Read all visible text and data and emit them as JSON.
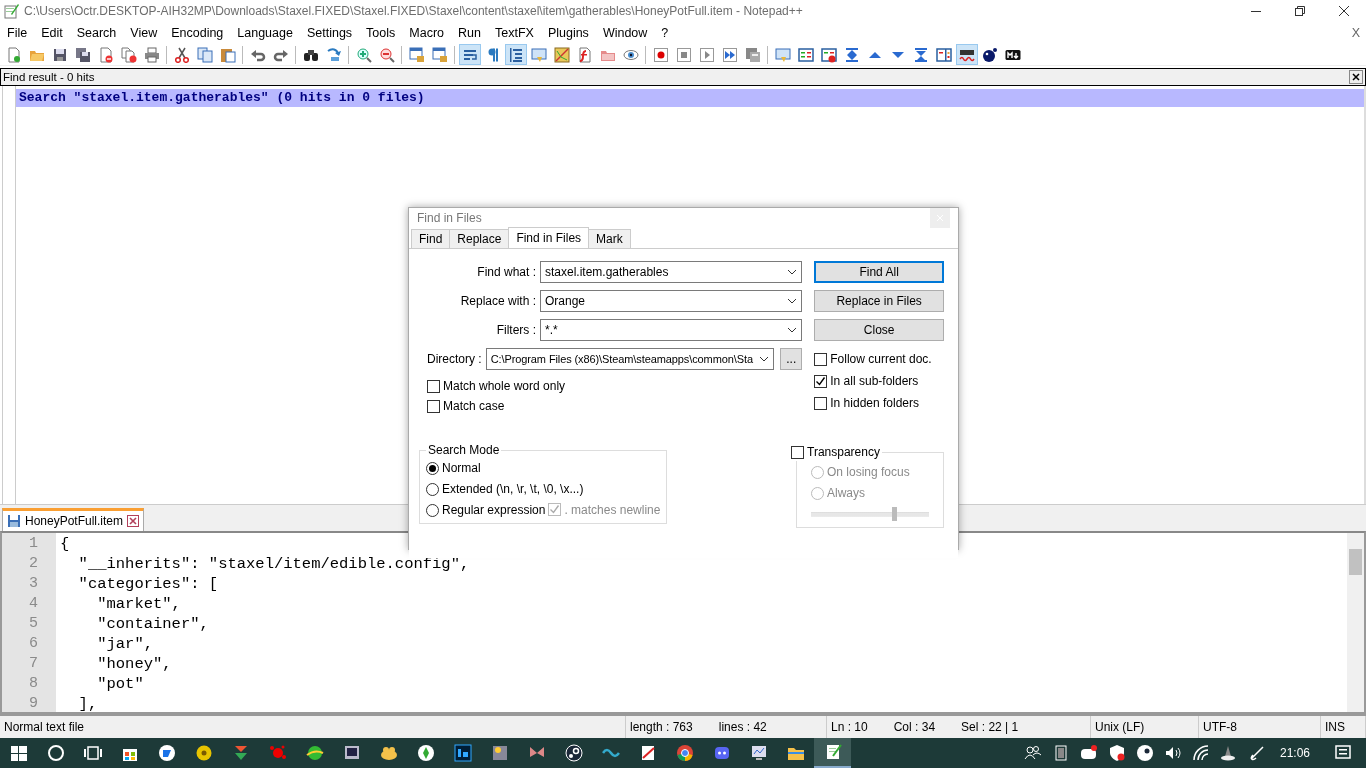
{
  "window": {
    "title": "C:\\Users\\Octr.DESKTOP-AIH32MP\\Downloads\\Staxel.FIXED\\Staxel.FIXED\\Staxel\\content\\staxel\\item\\gatherables\\HoneyPotFull.item - Notepad++"
  },
  "menu": [
    "File",
    "Edit",
    "Search",
    "View",
    "Encoding",
    "Language",
    "Settings",
    "Tools",
    "Macro",
    "Run",
    "TextFX",
    "Plugins",
    "Window",
    "?"
  ],
  "menu_close": "X",
  "toolbar": [
    {
      "on": false
    },
    {
      "on": false
    },
    {
      "on": false
    },
    {
      "on": false
    },
    {
      "on": false
    },
    {
      "on": false
    },
    {
      "on": false
    },
    {
      "on": false
    },
    {
      "on": false
    },
    {
      "on": false
    },
    {
      "on": false
    },
    {
      "on": false
    },
    {
      "on": false
    },
    {
      "on": false
    },
    {
      "on": false
    },
    {
      "on": false
    },
    {
      "on": false
    },
    {
      "on": false
    },
    {
      "on": true
    },
    {
      "on": false
    },
    {
      "on": true
    },
    {
      "on": false
    },
    {
      "on": false
    },
    {
      "on": false
    },
    {
      "on": false
    },
    {
      "on": false
    },
    {
      "on": false
    },
    {
      "on": false
    },
    {
      "on": false
    },
    {
      "on": false
    },
    {
      "on": false
    },
    {
      "on": false
    },
    {
      "on": false
    },
    {
      "on": false
    },
    {
      "on": false
    },
    {
      "on": false
    },
    {
      "on": false
    },
    {
      "on": false
    },
    {
      "on": false
    },
    {
      "on": true
    },
    {
      "on": false
    },
    {
      "on": false
    }
  ],
  "find_result": {
    "title": "Find result - 0 hits",
    "lines": [
      {
        "text": "Search \"staxel.item.gatherables\" (0 hits in 0 files)",
        "selected": true
      }
    ]
  },
  "tabs": [
    {
      "label": "HoneyPotFull.item",
      "selected": true
    }
  ],
  "editor": {
    "lines": [
      {
        "number": "1",
        "text": "{"
      },
      {
        "number": "2",
        "text": "  \"__inherits\": \"staxel/item/edible.config\","
      },
      {
        "number": "3",
        "text": "  \"categories\": ["
      },
      {
        "number": "4",
        "text": "    \"market\","
      },
      {
        "number": "5",
        "text": "    \"container\","
      },
      {
        "number": "6",
        "text": "    \"jar\","
      },
      {
        "number": "7",
        "text": "    \"honey\","
      },
      {
        "number": "8",
        "text": "    \"pot\""
      },
      {
        "number": "9",
        "text": "  ],"
      }
    ]
  },
  "dialog": {
    "title": "Find in Files",
    "tabs": [
      {
        "label": "Find",
        "selected": false
      },
      {
        "label": "Replace",
        "selected": false
      },
      {
        "label": "Find in Files",
        "selected": true
      },
      {
        "label": "Mark",
        "selected": false
      }
    ],
    "fields": [
      {
        "label": "Find what :",
        "value": "staxel.item.gatherables"
      },
      {
        "label": "Replace with :",
        "value": "Orange"
      },
      {
        "label": "Filters :",
        "value": "*.*"
      }
    ],
    "directory": {
      "label": "Directory :",
      "value": "C:\\Program Files (x86)\\Steam\\steamapps\\common\\Sta",
      "browse": "..."
    },
    "buttons": [
      {
        "label": "Find All",
        "default": true
      },
      {
        "label": "Replace in Files",
        "default": false
      },
      {
        "label": "Close",
        "default": false
      }
    ],
    "options_left": [
      {
        "label": "Match whole word only",
        "checked": false
      },
      {
        "label": "Match case",
        "checked": false
      }
    ],
    "options_right": [
      {
        "label": "Follow current doc.",
        "checked": false
      },
      {
        "label": "In all sub-folders",
        "checked": true
      },
      {
        "label": "In hidden folders",
        "checked": false
      }
    ],
    "search_mode": {
      "title": "Search Mode",
      "options": [
        {
          "label": "Normal",
          "selected": true
        },
        {
          "label": "Extended (\\n, \\r, \\t, \\0, \\x...)",
          "selected": false
        },
        {
          "label": "Regular expression",
          "selected": false
        }
      ],
      "dot_newline": {
        "label": ". matches newline",
        "checked": true,
        "disabled": true
      }
    },
    "transparency": {
      "label": "Transparency",
      "checked": false,
      "options": [
        {
          "label": "On losing focus",
          "selected": false
        },
        {
          "label": "Always",
          "selected": false
        }
      ],
      "level": 0.71
    }
  },
  "status_bar": [
    {
      "texts": [
        "Normal text file"
      ]
    },
    {
      "texts": [
        "length : 763",
        "lines : 42"
      ]
    },
    {
      "texts": [
        "Ln : 10",
        "Col : 34",
        "Sel : 22 | 1"
      ]
    },
    {
      "texts": [
        "Unix (LF)"
      ]
    },
    {
      "texts": [
        "UTF-8"
      ]
    },
    {
      "texts": [
        "INS"
      ]
    }
  ],
  "taskbar": {
    "clock": "21:06"
  }
}
